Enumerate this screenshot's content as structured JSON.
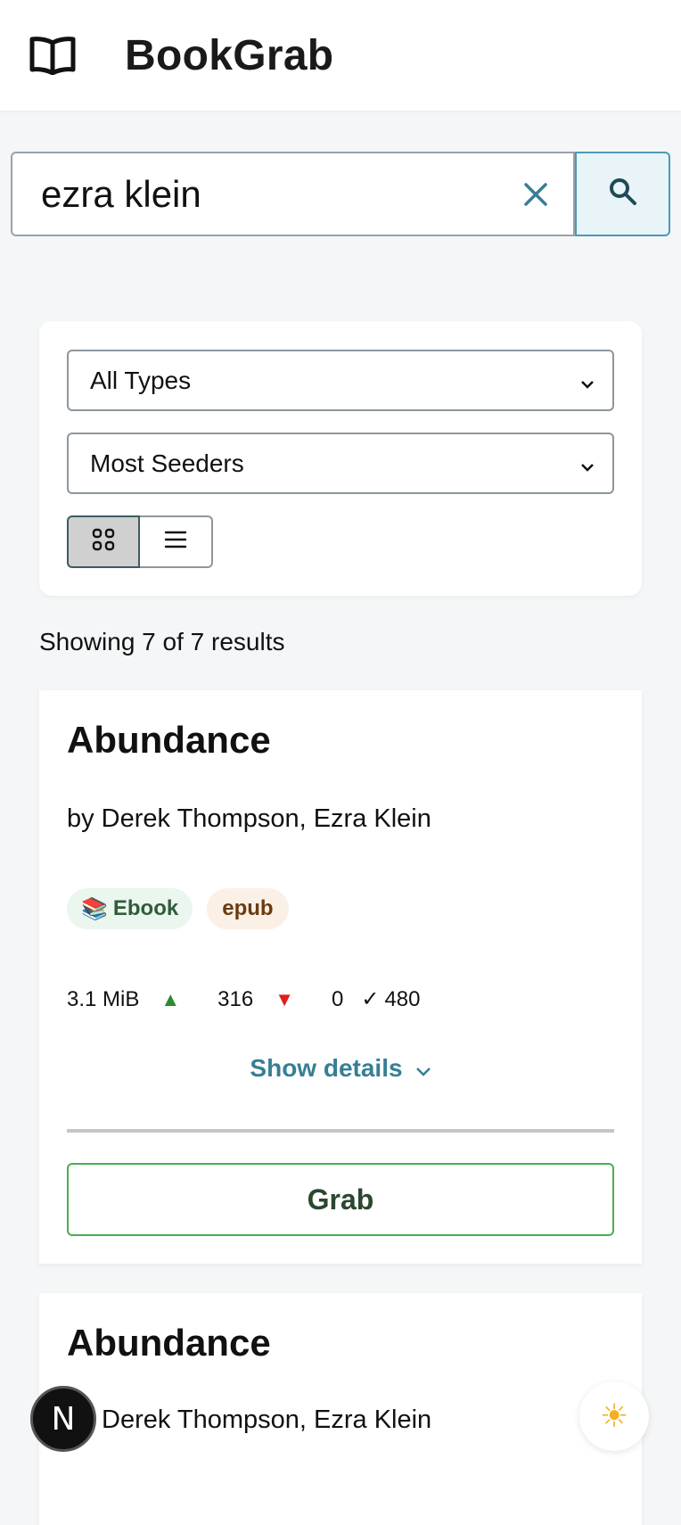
{
  "app": {
    "title": "BookGrab"
  },
  "search": {
    "value": "ezra klein",
    "placeholder": ""
  },
  "filters": {
    "type_selected": "All Types",
    "sort_selected": "Most Seeders",
    "view_mode": "grid"
  },
  "results": {
    "count_text": "Showing 7 of 7 results",
    "items": [
      {
        "title": "Abundance",
        "author": "by Derek Thompson, Ezra Klein",
        "type_icon": "📚",
        "type_label": "Ebook",
        "format": "epub",
        "size": "3.1 MiB",
        "seeders": "316",
        "leechers": "0",
        "completed": "480",
        "details_label": "Show details",
        "grab_label": "Grab"
      },
      {
        "title": "Abundance",
        "author": "Derek Thompson, Ezra Klein"
      }
    ]
  },
  "stats_symbols": {
    "seed": "▲",
    "leech": "▼",
    "check": "✓"
  },
  "floating": {
    "next_badge": "N",
    "theme_icon": "☀"
  },
  "colors": {
    "accent": "#367f96",
    "grab_border": "#4caf50",
    "seed": "#2e8a2e",
    "leech": "#e02020"
  }
}
